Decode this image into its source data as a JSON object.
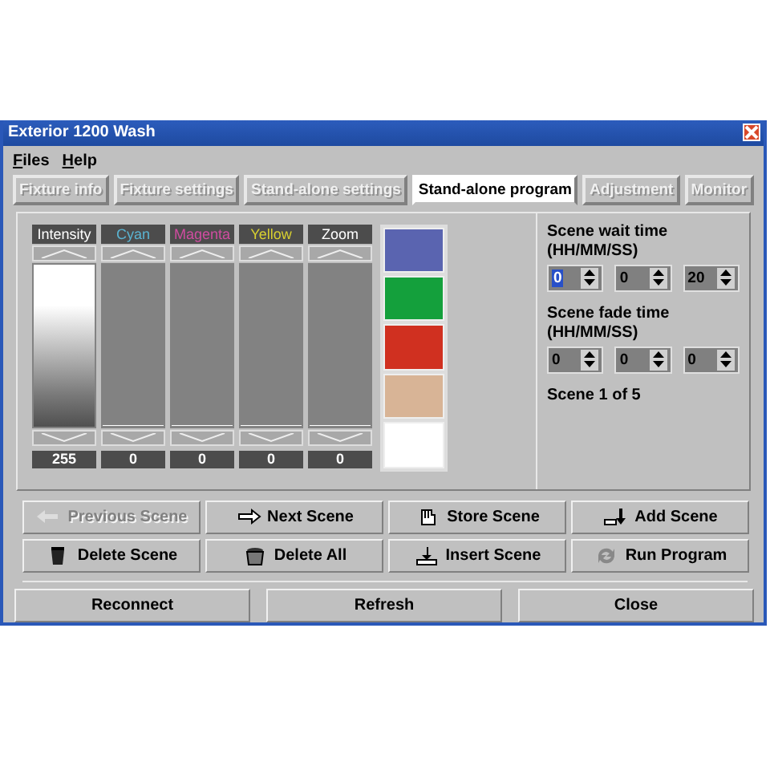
{
  "window": {
    "title": "Exterior 1200 Wash"
  },
  "menu": [
    {
      "label": "Files"
    },
    {
      "label": "Help"
    }
  ],
  "tabs": [
    {
      "label": "Fixture info",
      "selected": false
    },
    {
      "label": "Fixture settings",
      "selected": false
    },
    {
      "label": "Stand-alone settings",
      "selected": false
    },
    {
      "label": "Stand-alone program",
      "selected": true
    },
    {
      "label": "Adjustment",
      "selected": false
    },
    {
      "label": "Monitor",
      "selected": false
    }
  ],
  "sliders": [
    {
      "label": "Intensity",
      "color": "#ffffff",
      "level": 1,
      "reading": "255"
    },
    {
      "label": "Cyan",
      "color": "#5ab4d2",
      "level": 0,
      "reading": "0"
    },
    {
      "label": "Magenta",
      "color": "#d04ca0",
      "level": 0,
      "reading": "0"
    },
    {
      "label": "Yellow",
      "color": "#d8d030",
      "level": 0,
      "reading": "0"
    },
    {
      "label": "Zoom",
      "color": "#ffffff",
      "level": 0,
      "reading": "0"
    }
  ],
  "swatches": [
    {
      "color": "#5a64b0"
    },
    {
      "color": "#14a03c"
    },
    {
      "color": "#d03020"
    },
    {
      "color": "#d8b496"
    },
    {
      "color": "#ffffff"
    }
  ],
  "wait_time": {
    "label": "Scene wait time\n(HH/MM/SS)",
    "fields": [
      {
        "value": "0",
        "focused": true
      },
      {
        "value": "0",
        "focused": false
      },
      {
        "value": "20",
        "focused": false
      }
    ]
  },
  "fade_time": {
    "label": "Scene fade time\n(HH/MM/SS)",
    "fields": [
      {
        "value": "0",
        "focused": false
      },
      {
        "value": "0",
        "focused": false
      },
      {
        "value": "0",
        "focused": false
      }
    ]
  },
  "scene_info": "Scene 1 of 5",
  "scene_buttons": [
    {
      "label": "Previous Scene",
      "disabled": true
    },
    {
      "label": "Next Scene",
      "disabled": false
    },
    {
      "label": "Store Scene",
      "disabled": false
    },
    {
      "label": "Add Scene",
      "disabled": false
    },
    {
      "label": "Delete Scene",
      "disabled": false
    },
    {
      "label": "Delete All",
      "disabled": false
    },
    {
      "label": "Insert Scene",
      "disabled": false
    },
    {
      "label": "Run Program",
      "disabled": false
    }
  ],
  "bottom_buttons": [
    "Reconnect",
    "Refresh",
    "Close"
  ]
}
